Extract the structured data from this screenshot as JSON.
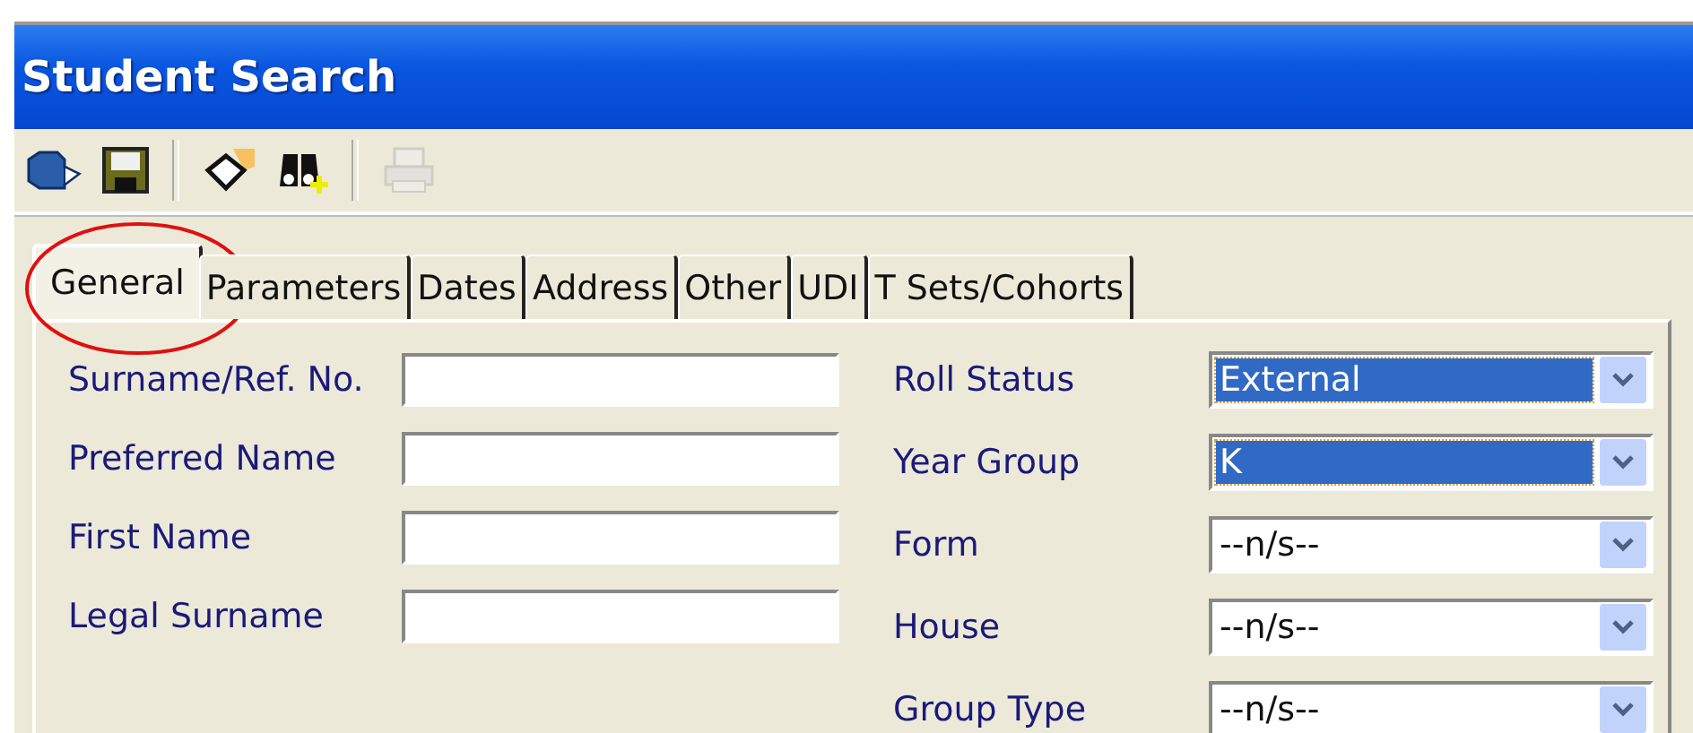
{
  "window": {
    "title": "Student Search"
  },
  "toolbar": [
    {
      "kind": "open",
      "disabled": false
    },
    {
      "kind": "save",
      "disabled": false
    },
    {
      "kind": "clear",
      "disabled": false
    },
    {
      "kind": "find",
      "disabled": false
    },
    {
      "kind": "print",
      "disabled": true
    }
  ],
  "tabs": [
    {
      "label": "General",
      "selected": true,
      "circled": true
    },
    {
      "label": "Parameters",
      "selected": false,
      "circled": false
    },
    {
      "label": "Dates",
      "selected": false,
      "circled": false
    },
    {
      "label": "Address",
      "selected": false,
      "circled": false
    },
    {
      "label": "Other",
      "selected": false,
      "circled": false
    },
    {
      "label": "UDI",
      "selected": false,
      "circled": false
    },
    {
      "label": "T Sets/Cohorts",
      "selected": false,
      "circled": false
    }
  ],
  "text_fields": [
    {
      "label": "Surname/Ref. No."
    },
    {
      "label": "Preferred Name"
    },
    {
      "label": "First Name"
    },
    {
      "label": "Legal Surname"
    }
  ],
  "dropdowns": [
    {
      "label": "Roll Status",
      "value": "External",
      "highlighted": true
    },
    {
      "label": "Year Group",
      "value": "K",
      "highlighted": true
    },
    {
      "label": "Form",
      "value": "--n/s--",
      "highlighted": false
    },
    {
      "label": "House",
      "value": "--n/s--",
      "highlighted": false
    },
    {
      "label": "Group Type",
      "value": "--n/s--",
      "highlighted": false
    }
  ]
}
